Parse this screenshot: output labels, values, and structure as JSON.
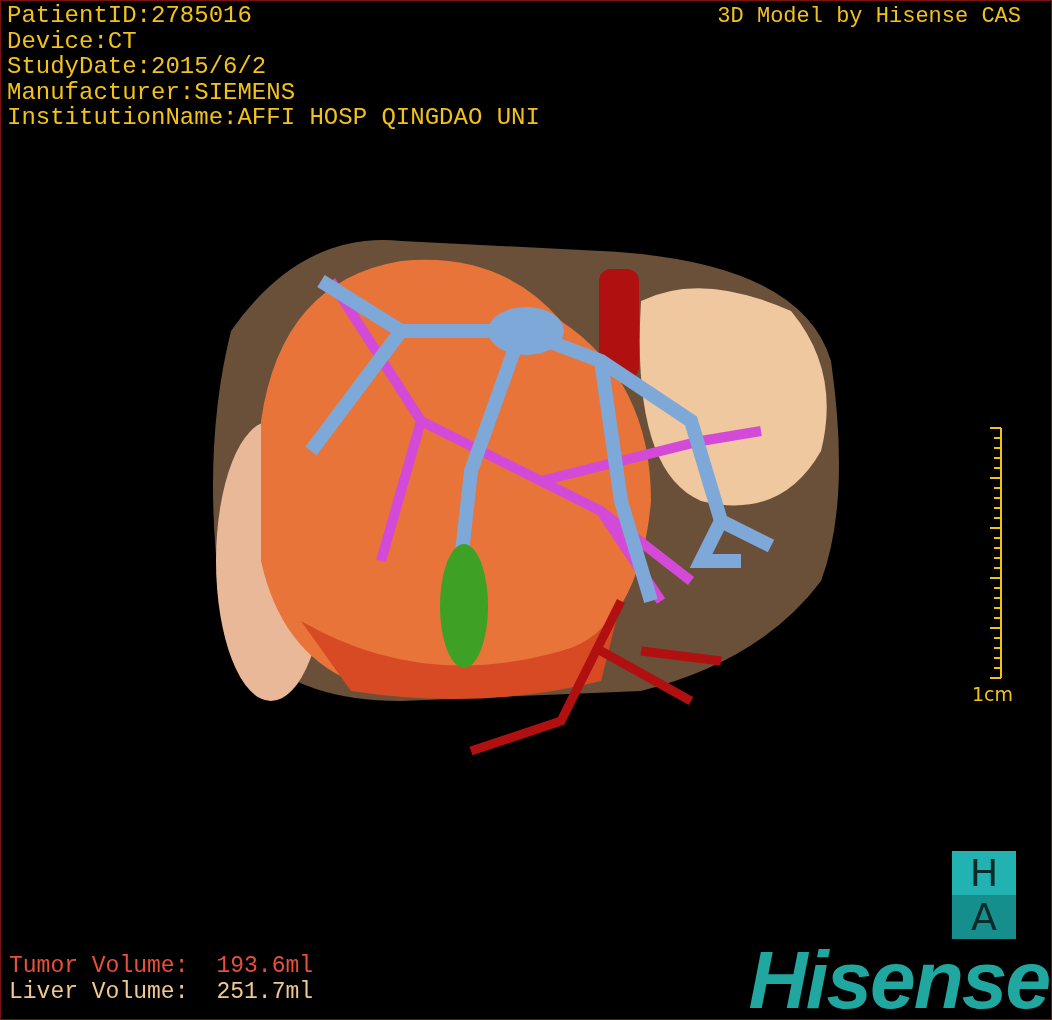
{
  "info_lines": [
    "PatientID:2785016",
    "Device:CT",
    "StudyDate:2015/6/2",
    "Manufacturer:SIEMENS",
    "InstitutionName:AFFI HOSP QINGDAO UNI"
  ],
  "title": "3D Model by Hisense CAS",
  "scale_bar": {
    "label": "1cm"
  },
  "volumes": [
    {
      "kind": "tumor",
      "label": "Tumor Volume:",
      "value": "193.6ml"
    },
    {
      "kind": "liver",
      "label": "Liver Volume:",
      "value": "251.7ml"
    }
  ],
  "logo": {
    "badge_top": "H",
    "badge_bottom": "A",
    "wordmark": "Hisense"
  }
}
